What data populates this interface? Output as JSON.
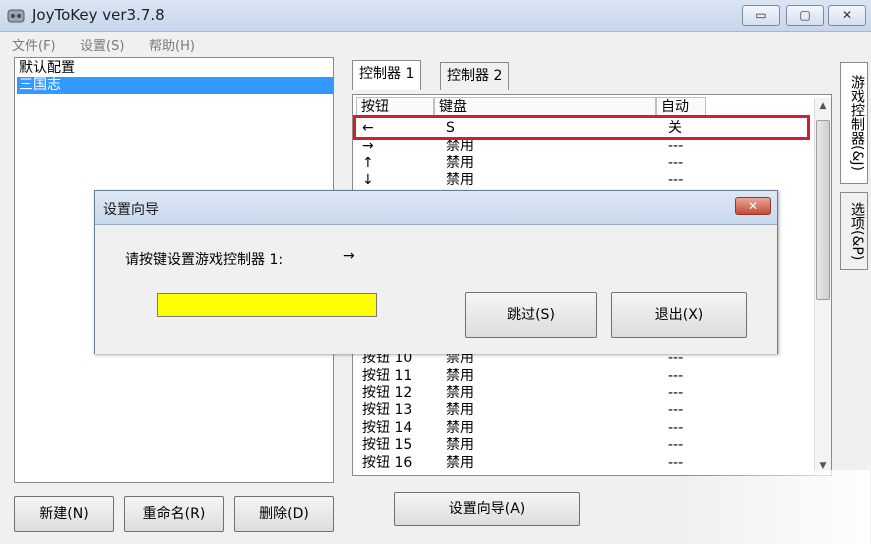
{
  "window": {
    "title": "JoyToKey ver3.7.8",
    "min": "▭",
    "max": "▢",
    "close": "✕"
  },
  "menu": {
    "file": "文件(F)",
    "settings": "设置(S)",
    "help": "帮助(H)"
  },
  "profiles": [
    "默认配置",
    "三国志"
  ],
  "buttons": {
    "new": "新建(N)",
    "rename": "重命名(R)",
    "delete": "删除(D)",
    "wizard": "设置向导(A)"
  },
  "tabs": {
    "ctrl1": "控制器 1",
    "ctrl2": "控制器 2"
  },
  "vtabs": {
    "game": "游戏控制器(&J)",
    "options": "选项(&P)"
  },
  "table": {
    "headers": {
      "button": "按钮",
      "key": "键盘",
      "auto": "自动"
    },
    "rows": [
      {
        "button": "←",
        "key": "S",
        "auto": "关"
      },
      {
        "button": "→",
        "key": "禁用",
        "auto": "---"
      },
      {
        "button": "↑",
        "key": "禁用",
        "auto": "---"
      },
      {
        "button": "↓",
        "key": "禁用",
        "auto": "---"
      },
      {
        "button": "按钮 10",
        "key": "禁用",
        "auto": "---"
      },
      {
        "button": "按钮 11",
        "key": "禁用",
        "auto": "---"
      },
      {
        "button": "按钮 12",
        "key": "禁用",
        "auto": "---"
      },
      {
        "button": "按钮 13",
        "key": "禁用",
        "auto": "---"
      },
      {
        "button": "按钮 14",
        "key": "禁用",
        "auto": "---"
      },
      {
        "button": "按钮 15",
        "key": "禁用",
        "auto": "---"
      },
      {
        "button": "按钮 16",
        "key": "禁用",
        "auto": "---"
      }
    ]
  },
  "dialog": {
    "title": "设置向导",
    "prompt": "请按键设置游戏控制器 1:",
    "arrow": "→",
    "skip": "跳过(S)",
    "exit": "退出(X)",
    "close": "✕",
    "field_color": "#ffff00"
  },
  "scroll": {
    "up": "▲",
    "down": "▼"
  },
  "colors": {
    "selection": "#3399ff",
    "highlight": "#d02030"
  }
}
